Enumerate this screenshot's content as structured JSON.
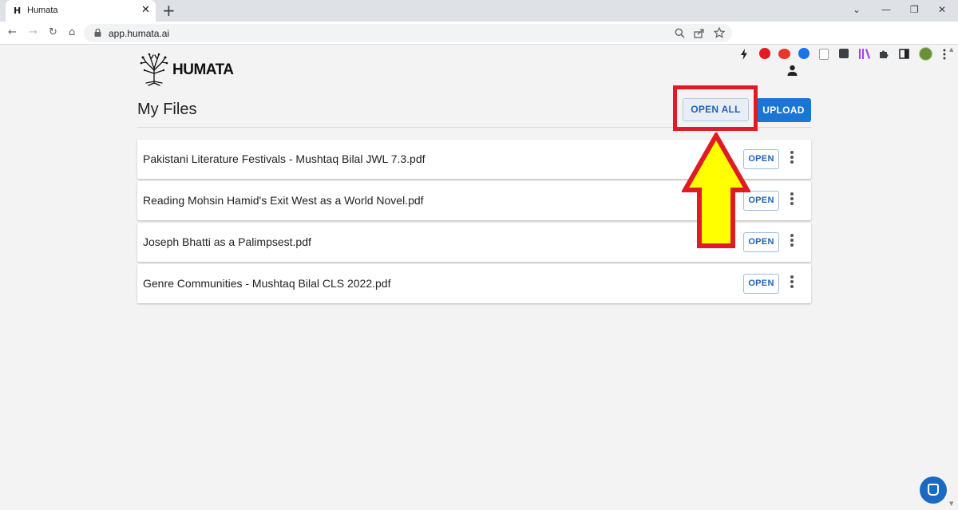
{
  "browser": {
    "tab": {
      "favicon": "H",
      "title": "Humata",
      "close": "✕"
    },
    "new_tab": "+",
    "window_controls": {
      "dropdown": "⌄",
      "minimize": "—",
      "restore": "❐",
      "close": "✕"
    },
    "nav": {
      "back": "←",
      "forward": "→",
      "reload": "↻",
      "home": "⌂"
    },
    "url": "app.humata.ai",
    "omnibox_icons": [
      "zoom-icon",
      "share-icon",
      "star-icon"
    ],
    "extension_icons": [
      "lightning-icon",
      "opera-icon",
      "adblock-icon",
      "extension-icon",
      "doc-icon",
      "extension-icon",
      "library-icon",
      "puzzle-icon",
      "side-panel-icon",
      "profile-avatar",
      "menu-icon"
    ]
  },
  "app": {
    "logo_text": "HUMATA",
    "page_title": "My Files",
    "open_all_label": "OPEN ALL",
    "upload_label": "UPLOAD",
    "open_label": "OPEN",
    "files": [
      {
        "name": "Pakistani Literature Festivals - Mushtaq Bilal JWL 7.3.pdf"
      },
      {
        "name": "Reading Mohsin Hamid's Exit West as a World Novel.pdf"
      },
      {
        "name": "Joseph Bhatti as a Palimpsest.pdf"
      },
      {
        "name": "Genre Communities - Mushtaq Bilal CLS 2022.pdf"
      }
    ]
  },
  "colors": {
    "accent": "#1976d2",
    "highlight_box": "#e01b24",
    "arrow_fill": "#ffff00",
    "arrow_stroke": "#e01b24"
  }
}
